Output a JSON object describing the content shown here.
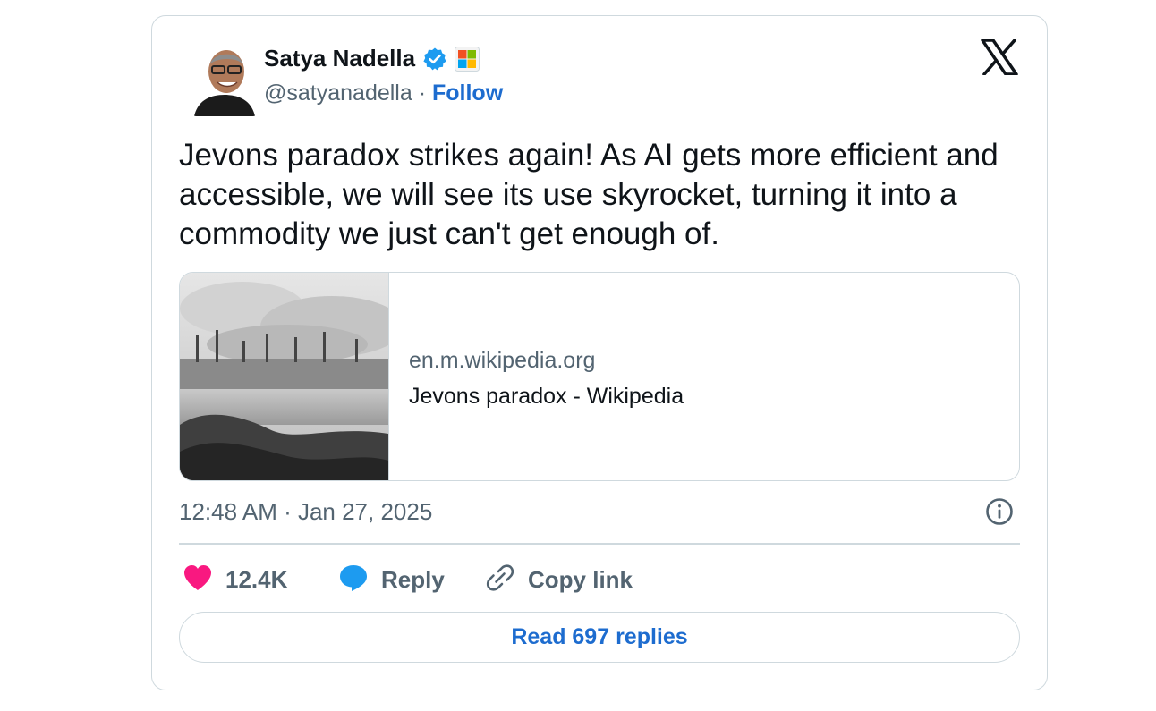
{
  "author": {
    "name": "Satya Nadella",
    "handle": "@satyanadella",
    "separator": "·",
    "follow_label": "Follow"
  },
  "tweet": {
    "text": "Jevons paradox strikes again! As AI gets more efficient and accessible, we will see its use skyrocket, turning it into a commodity we just can't get enough of."
  },
  "link_card": {
    "domain": "en.m.wikipedia.org",
    "title": "Jevons paradox - Wikipedia"
  },
  "timestamp": "12:48 AM · Jan 27, 2025",
  "actions": {
    "like_count": "12.4K",
    "reply_label": "Reply",
    "copy_label": "Copy link"
  },
  "read_replies_label": "Read 697 replies",
  "icons": {
    "verified": "verified-badge-icon",
    "affiliate": "microsoft-affiliate-icon",
    "logo": "x-logo-icon",
    "info": "info-icon",
    "like": "heart-icon",
    "reply": "speech-bubble-icon",
    "copy": "link-icon"
  },
  "colors": {
    "text": "#0f1419",
    "secondary": "#536471",
    "link": "#1d6ccf",
    "verified": "#1d9bf0",
    "heart": "#f91880",
    "reply_bubble": "#1d9bf0",
    "border": "#cfd9de"
  }
}
